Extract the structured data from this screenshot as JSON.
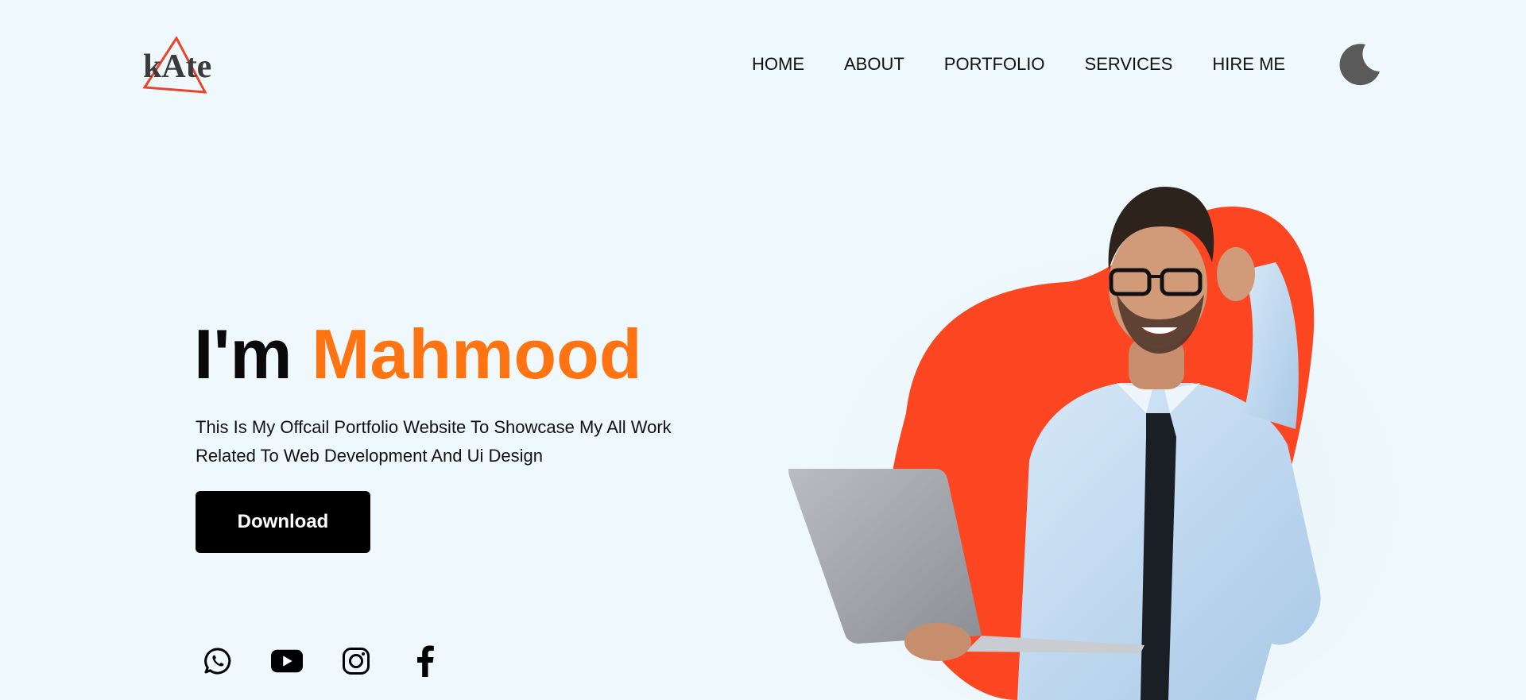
{
  "header": {
    "logo_text": "kAte",
    "nav": [
      {
        "label": "HOME"
      },
      {
        "label": "ABOUT"
      },
      {
        "label": "PORTFOLIO"
      },
      {
        "label": "SERVICES"
      },
      {
        "label": "HIRE ME"
      }
    ],
    "theme_toggle_icon": "moon-icon"
  },
  "hero": {
    "greeting": "I'm",
    "name": "Mahmood",
    "description": "This Is My Offcail Portfolio Website To Showcase My All Work Related To Web Development And Ui Design",
    "download_label": "Download",
    "socials": [
      {
        "icon": "whatsapp-icon"
      },
      {
        "icon": "youtube-icon"
      },
      {
        "icon": "instagram-icon"
      },
      {
        "icon": "facebook-icon"
      }
    ]
  },
  "colors": {
    "background": "#eff8fc",
    "accent": "#ff7410",
    "blob": "#fc4621",
    "logo_triangle": "#e8452a",
    "moon": "#5a5a5a",
    "button_bg": "#000000"
  }
}
